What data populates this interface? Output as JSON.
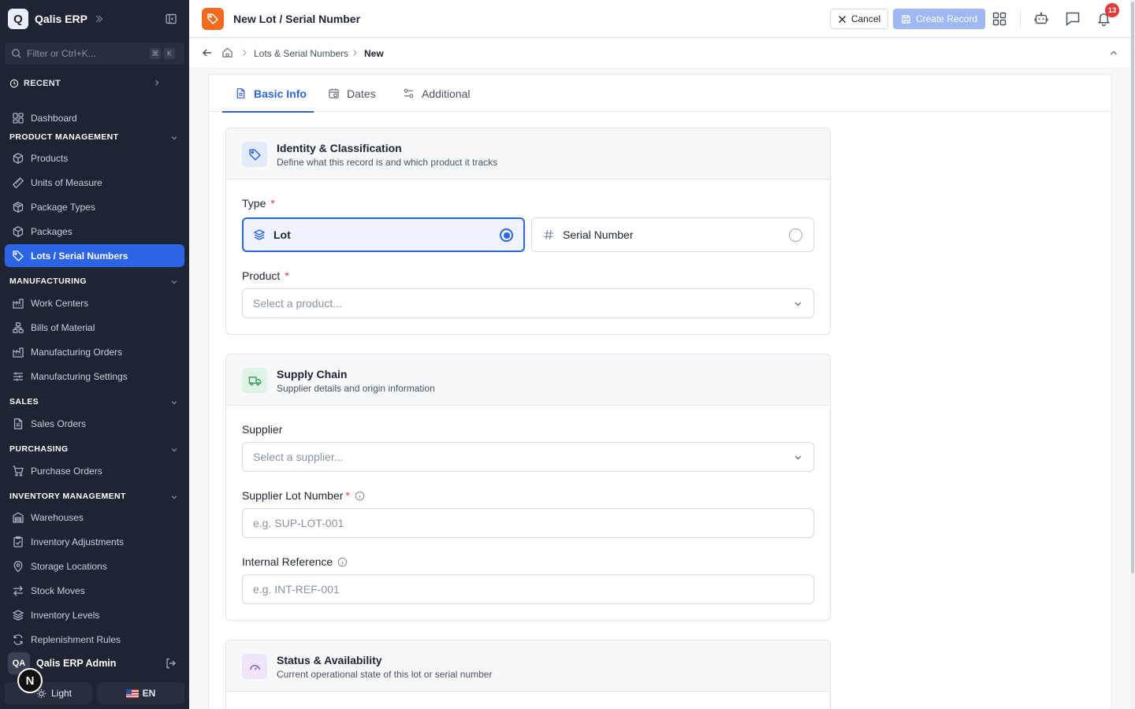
{
  "brand": {
    "logo_letter": "Q",
    "name": "Qalis ERP"
  },
  "sidebar": {
    "filter_placeholder": "Filter or Ctrl+K...",
    "filter_keys": [
      "⌘",
      "K"
    ],
    "recent_label": "RECENT",
    "dashboard": "Dashboard",
    "sections": {
      "product": "PRODUCT MANAGEMENT",
      "manufacturing": "MANUFACTURING",
      "sales": "SALES",
      "purchasing": "PURCHASING",
      "inventory": "INVENTORY MANAGEMENT"
    },
    "items": {
      "products": "Products",
      "uom": "Units of Measure",
      "package_types": "Package Types",
      "packages": "Packages",
      "lots": "Lots / Serial Numbers",
      "work_centers": "Work Centers",
      "bom": "Bills of Material",
      "mo": "Manufacturing Orders",
      "mfg_settings": "Manufacturing Settings",
      "sales_orders": "Sales Orders",
      "purchase_orders": "Purchase Orders",
      "warehouses": "Warehouses",
      "inv_adjust": "Inventory Adjustments",
      "storage": "Storage Locations",
      "stock_moves": "Stock Moves",
      "inv_levels": "Inventory Levels",
      "replenishment": "Replenishment Rules"
    },
    "user": {
      "initials": "QA",
      "name": "Qalis ERP Admin"
    },
    "theme_label": "Light",
    "lang_label": "EN",
    "n_badge": "N"
  },
  "topbar": {
    "title": "New Lot / Serial Number",
    "cancel_label": "Cancel",
    "create_label": "Create Record",
    "notification_count": "13"
  },
  "breadcrumb": {
    "parent": "Lots & Serial Numbers",
    "current": "New"
  },
  "tabs": {
    "basic": "Basic Info",
    "dates": "Dates",
    "additional": "Additional"
  },
  "identity": {
    "title": "Identity & Classification",
    "subtitle": "Define what this record is and which product it tracks",
    "type_label": "Type",
    "option_lot": "Lot",
    "option_serial": "Serial Number",
    "product_label": "Product",
    "product_placeholder": "Select a product..."
  },
  "supply": {
    "title": "Supply Chain",
    "subtitle": "Supplier details and origin information",
    "supplier_label": "Supplier",
    "supplier_placeholder": "Select a supplier...",
    "lot_number_label": "Supplier Lot Number",
    "lot_number_placeholder": "e.g. SUP-LOT-001",
    "internal_ref_label": "Internal Reference",
    "internal_ref_placeholder": "e.g. INT-REF-001"
  },
  "status": {
    "title": "Status & Availability",
    "subtitle": "Current operational state of this lot or serial number"
  },
  "colors": {
    "primary": "#2c64e6",
    "sidebar": "#1f2433",
    "accent_orange": "#f26b1d",
    "required": "#e5383b"
  }
}
